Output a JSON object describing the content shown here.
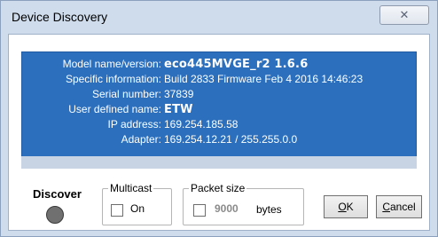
{
  "window": {
    "title": "Device Discovery",
    "close_glyph": "✕"
  },
  "info": {
    "rows": [
      {
        "label": "Model name/version:",
        "value": "eco445MVGE_r2  1.6.6"
      },
      {
        "label": "Specific information:",
        "value": "Build 2833 Firmware Feb  4 2016 14:46:23"
      },
      {
        "label": "Serial number:",
        "value": "37839"
      },
      {
        "label": "User defined name:",
        "value": "ETW"
      },
      {
        "label": "IP address:",
        "value": "169.254.185.58"
      },
      {
        "label": "Adapter:",
        "value": "169.254.12.21 / 255.255.0.0"
      }
    ]
  },
  "discover": {
    "label": "Discover"
  },
  "multicast": {
    "legend": "Multicast",
    "checkbox_label": "On"
  },
  "packet_size": {
    "legend": "Packet size",
    "value": "9000",
    "unit": "bytes"
  },
  "buttons": {
    "ok_first": "O",
    "ok_rest": "K",
    "cancel_first": "C",
    "cancel_rest": "ancel"
  },
  "icons": {
    "close": "close-icon",
    "status": "status-indicator-icon"
  },
  "colors": {
    "panel": "#2b6fbd",
    "titlebar": "#cfdcec",
    "status_led": "#707070"
  }
}
